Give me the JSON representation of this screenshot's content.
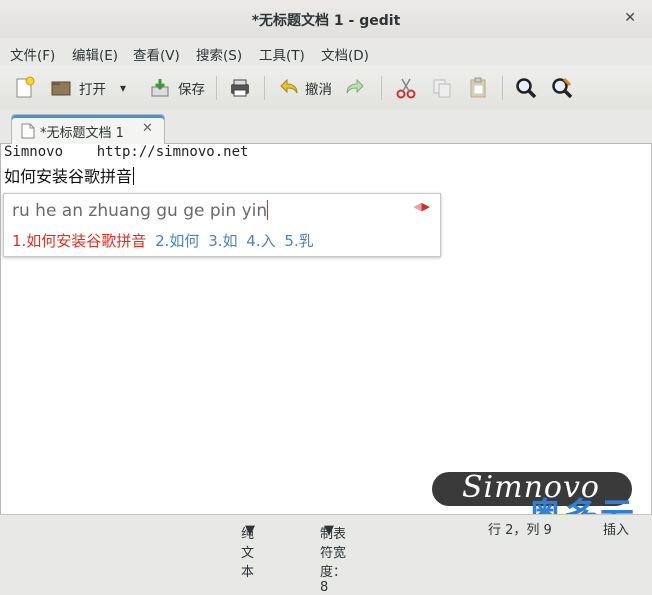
{
  "window": {
    "title": "*无标题文档 1 - gedit",
    "close_icon": "✕"
  },
  "menu": {
    "file": "文件(F)",
    "edit": "编辑(E)",
    "view": "查看(V)",
    "search": "搜索(S)",
    "tools": "工具(T)",
    "documents": "文档(D)"
  },
  "toolbar": {
    "open_label": "打开",
    "save_label": "保存",
    "undo_label": "撤消"
  },
  "tab": {
    "label": "*无标题文档 1",
    "close": "✕"
  },
  "editor": {
    "line1": "Simnovo    http://simnovo.net",
    "line2": "如何安装谷歌拼音"
  },
  "ime": {
    "preedit": "ru he an zhuang gu ge pin yin",
    "candidates": [
      "1.如何安装谷歌拼音",
      "2.如何",
      "3.如",
      "4.入",
      "5.乳"
    ],
    "accent_color": "#e0301e",
    "candidate_color": "#4a84c4"
  },
  "watermark": {
    "text": "Simnovo",
    "cn_text": "奥多云"
  },
  "status": {
    "mode": "纯文本",
    "tab_width": "制表符宽度：8",
    "position": "行 2，列 9",
    "insert_mode": "插入"
  }
}
